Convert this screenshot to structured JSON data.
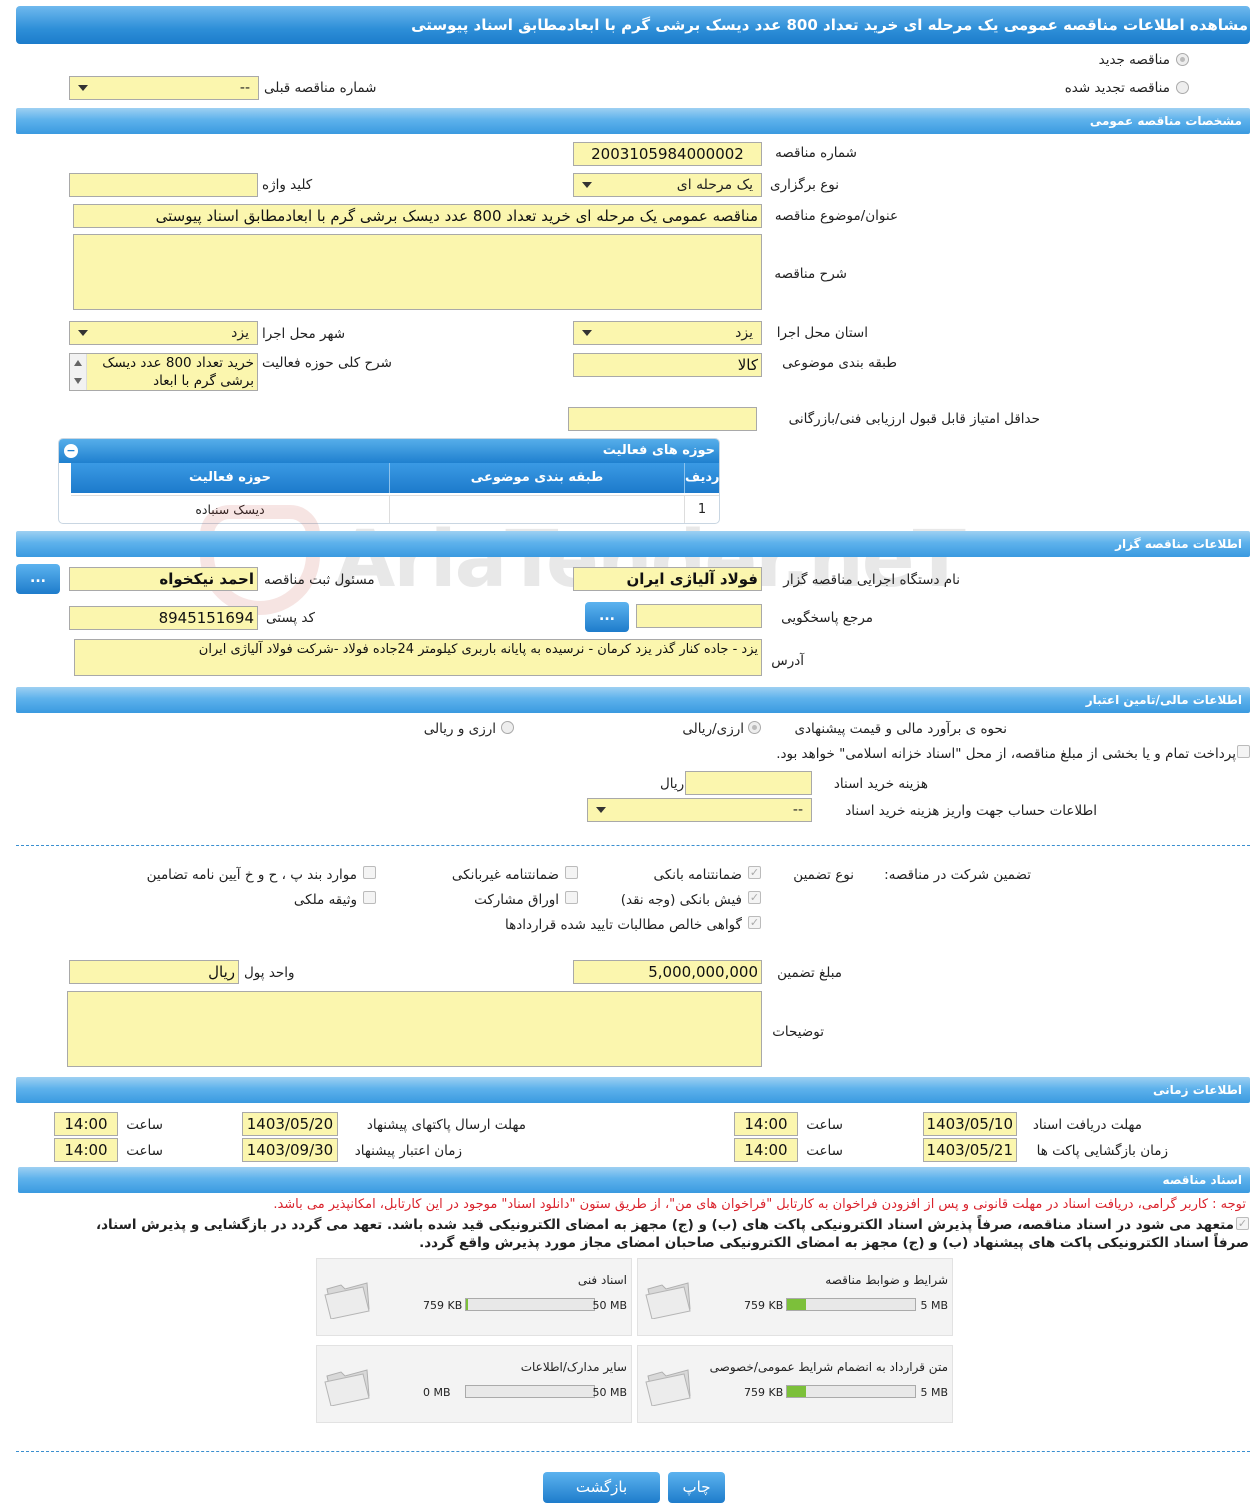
{
  "page_title": "مشاهده اطلاعات مناقصه عمومی یک مرحله ای خرید تعداد 800 عدد دیسک برشی گرم با ابعادمطابق اسناد پیوستی",
  "top": {
    "new_tender": "مناقصه جدید",
    "renewed_tender": "مناقصه تجدید شده",
    "prev_number_label": "شماره مناقصه قبلی",
    "prev_number_value": "--"
  },
  "general": {
    "section": "مشخصات مناقصه عمومی",
    "number_label": "شماره مناقصه",
    "number_value": "2003105984000002",
    "type_label": "نوع برگزاری",
    "type_value": "یک مرحله ای",
    "keyword_label": "کلید واژه",
    "keyword_value": "",
    "subject_label": "عنوان/موضوع مناقصه",
    "subject_value": "مناقصه عمومی یک مرحله ای خرید تعداد 800 عدد دیسک برشی گرم با ابعادمطابق اسناد پیوستی",
    "desc_label": "شرح مناقصه",
    "desc_value": "",
    "province_label": "استان محل اجرا",
    "province_value": "یزد",
    "city_label": "شهر محل اجرا",
    "city_value": "یزد",
    "category_label": "طبقه بندی موضوعی",
    "category_value": "کالا",
    "activity_desc_label": "شرح کلی حوزه فعالیت",
    "activity_desc_value": "خرید تعداد 800 عدد دیسک برشی گرم با ابعاد",
    "min_score_label": "حداقل امتیاز قابل قبول ارزیابی فنی/بازرگانی",
    "min_score_value": ""
  },
  "activity_table": {
    "title": "حوزه های فعالیت",
    "columns": [
      "ردیف",
      "طبقه بندی موضوعی",
      "حوزه فعالیت"
    ],
    "rows": [
      [
        "1",
        "",
        "دیسک سنباده"
      ]
    ]
  },
  "organizer": {
    "section": "اطلاعات مناقصه گزار",
    "org_label": "نام دستگاه اجرایی مناقصه گزار",
    "org_value": "فولاد آلیاژی ایران",
    "responsible_label": "مسئول ثبت مناقصه",
    "responsible_value": "احمد نیکخواه",
    "ref_label": "مرجع پاسخگویی",
    "ref_value": "",
    "postal_label": "کد پستی",
    "postal_value": "8945151694",
    "address_label": "آدرس",
    "address_value": "یزد - جاده کنار گذر یزد کرمان - نرسیده به پایانه باربری کیلومتر 24جاده فولاد -شرکت فولاد آلیاژی ایران",
    "more_button": "..."
  },
  "finance": {
    "section": "اطلاعات مالی/تامین اعتبار",
    "estimate_label": "نحوه ی برآورد مالی و قیمت پیشنهادی",
    "opt_currency_rial": "ارزی/ریالی",
    "opt_currency_and_rial": "ارزی و ریالی",
    "treasury_text": "پرداخت تمام و یا بخشی از مبلغ مناقصه، از محل \"اسناد خزانه اسلامی\" خواهد بود.",
    "doc_fee_label": "هزینه خرید اسناد",
    "doc_fee_value": "",
    "doc_fee_unit": "ریال",
    "account_label": "اطلاعات حساب جهت واریز هزینه خرید اسناد",
    "account_value": "--"
  },
  "guarantee": {
    "label": "تضمین شرکت در مناقصه:",
    "type_label": "نوع تضمین",
    "items": {
      "bank_guarantee": "ضمانتنامه بانکی",
      "non_bank_guarantee": "ضمانتنامه غیربانکی",
      "cases": "موارد بند پ ، ح و خ آیین نامه تضامین",
      "bank_receipt": "فیش بانکی (وجه نقد)",
      "bonds": "اوراق مشارکت",
      "property": "وثیقه ملکی",
      "receivables": "گواهی خالص مطالبات تایید شده قراردادها"
    },
    "amount_label": "مبلغ تضمین",
    "amount_value": "5,000,000,000",
    "currency_label": "واحد پول",
    "currency_value": "ریال",
    "notes_label": "توضیحات",
    "notes_value": ""
  },
  "timing": {
    "section": "اطلاعات زمانی",
    "doc_deadline_label": "مهلت دریافت اسناد",
    "doc_deadline_date": "1403/05/10",
    "doc_deadline_time": "14:00",
    "send_deadline_label": "مهلت ارسال پاکتهای پیشنهاد",
    "send_deadline_date": "1403/05/20",
    "send_deadline_time": "14:00",
    "opening_label": "زمان بازگشایی پاکت ها",
    "opening_date": "1403/05/21",
    "opening_time": "14:00",
    "validity_label": "زمان اعتبار پیشنهاد",
    "validity_date": "1403/09/30",
    "validity_time": "14:00",
    "time_label": "ساعت"
  },
  "documents": {
    "section": "اسناد مناقصه",
    "notice": "توجه : کاربر گرامی، دریافت اسناد در مهلت قانونی و پس از افزودن فراخوان به کارتابل \"فراخوان های من\"، از طریق ستون \"دانلود اسناد\" موجود در این کارتابل، امکانپذیر می باشد.",
    "commit_line1": "متعهد می شود در اسناد مناقصه، صرفاً پذیرش اسناد الکترونیکی پاکت های (ب) و (ج) مجهز به امضای الکترونیکی قید شده باشد. تعهد می گردد در بازگشایی و پذیرش اسناد،",
    "commit_line2": "صرفاً اسناد الکترونیکی پاکت های پیشنهاد (ب) و (ج) مجهز به امضای الکترونیکی صاحبان امضای مجاز مورد پذیرش واقع گردد.",
    "files": [
      {
        "name": "شرایط و ضوابط مناقصه",
        "size": "759 KB",
        "max": "5 MB",
        "fill": 0.15
      },
      {
        "name": "اسناد فنی",
        "size": "759 KB",
        "max": "50 MB",
        "fill": 0.015
      },
      {
        "name": "متن قرارداد به انضمام شرایط عمومی/خصوصی",
        "size": "759 KB",
        "max": "5 MB",
        "fill": 0.15
      },
      {
        "name": "سایر مدارک/اطلاعات",
        "size": "0 MB",
        "max": "50 MB",
        "fill": 0
      }
    ]
  },
  "buttons": {
    "print": "چاپ",
    "back": "بازگشت"
  },
  "watermark": "AriaTender.neT"
}
